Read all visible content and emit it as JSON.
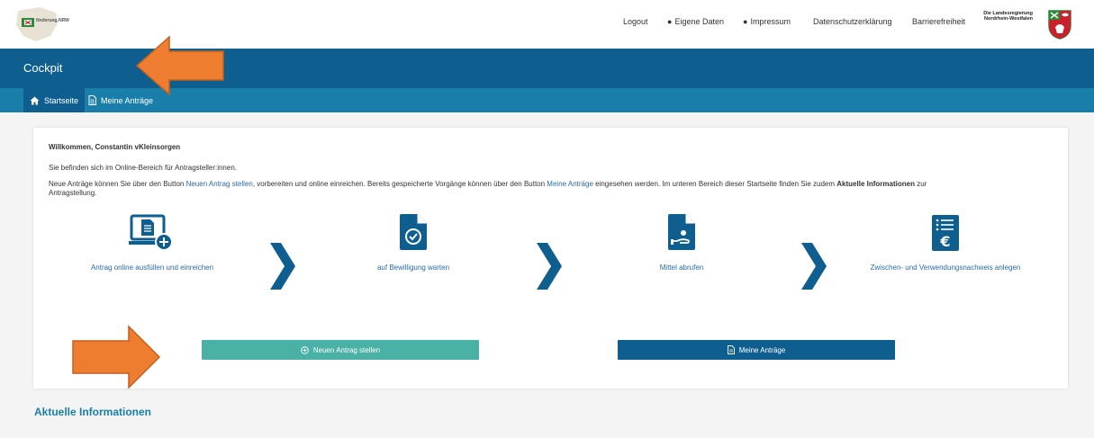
{
  "header": {
    "logo_text": "förderung.NRW",
    "nav": {
      "logout": "Logout",
      "eigene_daten": "Eigene Daten",
      "impressum": "Impressum",
      "datenschutz": "Datenschutzerklärung",
      "barrierefreiheit": "Barrierefreiheit"
    },
    "landesregierung_line1": "Die Landesregierung",
    "landesregierung_line2": "Nordrhein-Westfalen"
  },
  "page": {
    "title": "Cockpit",
    "tabs": [
      "Startseite",
      "Meine Anträge"
    ]
  },
  "card": {
    "welcome": "Willkommen, Constantin vKleinsorgen",
    "intro": "Sie befinden sich im Online-Bereich für Antragsteller:innen.",
    "desc_part1": "Neue Anträge können Sie über den Button ",
    "desc_link1": "Neuen Antrag stellen",
    "desc_part2": ", vorbereiten und online einreichen. Bereits gespeicherte Vorgänge können über den Button ",
    "desc_link2": "Meine Anträge",
    "desc_part3": " eingesehen werden. Im unteren Bereich dieser Startseite finden Sie zudem ",
    "desc_bold": "Aktuelle Informationen",
    "desc_part4": " zur",
    "desc_part5": "Antragstellung.",
    "steps": [
      {
        "label": "Antrag online ausfüllen und einreichen",
        "icon": "laptop-document-plus-icon"
      },
      {
        "label": "auf Bewilligung warten",
        "icon": "document-check-icon"
      },
      {
        "label": "Mittel abrufen",
        "icon": "document-hand-coin-icon"
      },
      {
        "label": "Zwischen- und Verwendungsnachweis anlegen",
        "icon": "document-euro-icon"
      }
    ],
    "btn_new": "Neuen Antrag stellen",
    "btn_mine": "Meine Anträge"
  },
  "section_title": "Aktuelle Informationen",
  "colors": {
    "primary": "#0e5f8f",
    "secondary": "#1a7eab",
    "teal": "#4ab1a6",
    "annotation_arrow": "#ee7d30"
  }
}
